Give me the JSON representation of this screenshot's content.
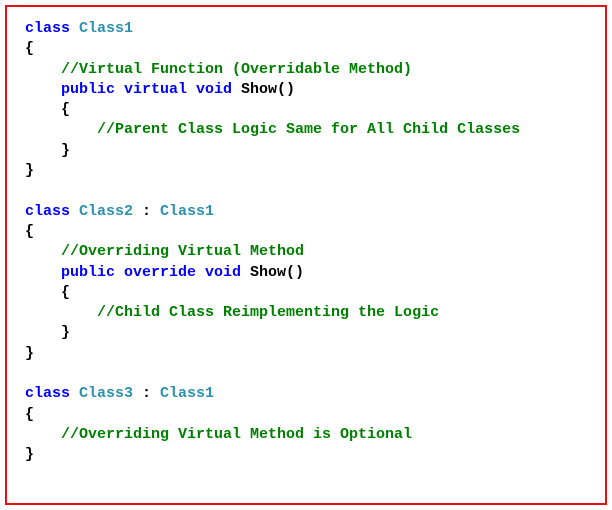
{
  "code": {
    "line01_kw": "class",
    "line01_type": " Class1",
    "line02": "{",
    "line03_comment": "    //Virtual Function (Overridable Method)",
    "line04_indent": "    ",
    "line04_kw": "public virtual void",
    "line04_method": " Show()",
    "line05": "    {",
    "line06_comment": "        //Parent Class Logic Same for All Child Classes",
    "line07": "    }",
    "line08": "}",
    "line09": " ",
    "line10_kw": "class",
    "line10_type": " Class2",
    "line10_colon": " : ",
    "line10_base": "Class1",
    "line11": "{",
    "line12_comment": "    //Overriding Virtual Method",
    "line13_indent": "    ",
    "line13_kw": "public override void",
    "line13_method": " Show()",
    "line14": "    {",
    "line15_comment": "        //Child Class Reimplementing the Logic",
    "line16": "    }",
    "line17": "}",
    "line18": " ",
    "line19_kw": "class",
    "line19_type": " Class3",
    "line19_colon": " : ",
    "line19_base": "Class1",
    "line20": "{",
    "line21_comment": "    //Overriding Virtual Method is Optional",
    "line22": "}"
  }
}
